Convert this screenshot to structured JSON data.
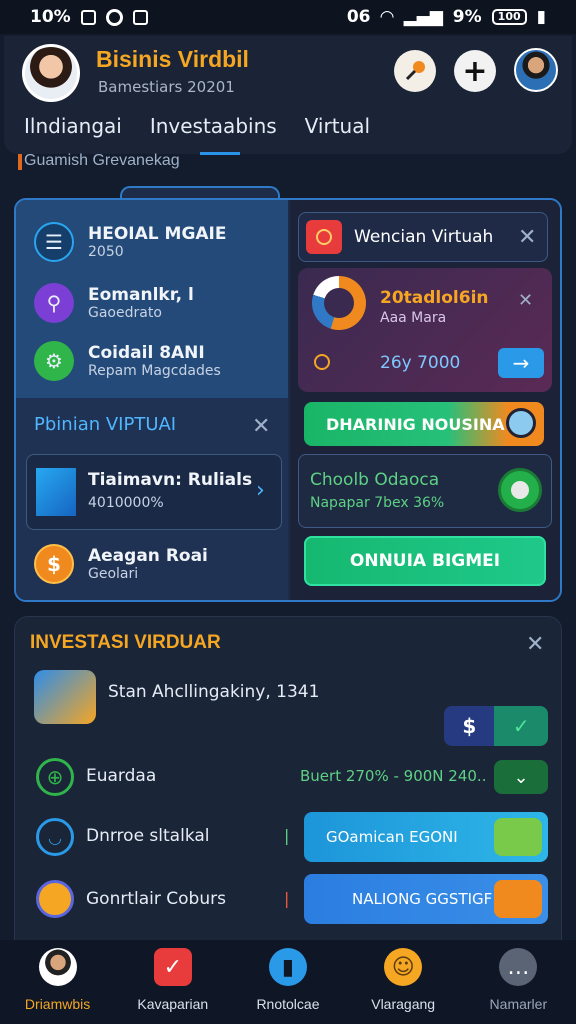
{
  "status_bar": {
    "left_time": "10%",
    "right_text": "06",
    "battery_pct": "9%",
    "battery_label": "100"
  },
  "header": {
    "title": "Bisinis Virdbil",
    "subtitle": "Bamestiars 20201",
    "tabs": [
      {
        "label": "Ilndiangai"
      },
      {
        "label": "Investaabins"
      },
      {
        "label": "Virtual"
      }
    ],
    "section_caption": "Guamish Grevanekag"
  },
  "left_items": [
    {
      "title": "HEOIAL MGAIE",
      "subtitle": "2050",
      "icon": "list-icon",
      "color": "#1e8fd8"
    },
    {
      "title": "Eomanlkr, l",
      "subtitle": "Gaoedrato",
      "icon": "pin-icon",
      "color": "#7c3fd6"
    },
    {
      "title": "Coidail 8ANI",
      "subtitle": "Repam Magcdades",
      "icon": "gear-icon",
      "color": "#2fb54a"
    }
  ],
  "pbinian": {
    "title": "Pbinian VIPTUAI"
  },
  "mini_card": {
    "title": "Tiaimavn: Rulials",
    "subtitle": "4010000%"
  },
  "coin_item": {
    "title": "Aeagan Roai",
    "subtitle": "Geolari"
  },
  "right": {
    "wencian_label": "Wencian Virtuah",
    "gauge_card": {
      "title": "20tadlol6in",
      "subtitle": "Aaa Mara",
      "value": "26y 7000"
    },
    "search_button_label": "DHARINIG NOUSINA",
    "choolb": {
      "title": "Choolb Odaoca",
      "subtitle": "Napapar 7bex 36%"
    },
    "green_button_label": "ONNUIA BIGMEI"
  },
  "invest": {
    "title": "INVESTASI VIRDUAR",
    "rows": [
      {
        "label": "Stan Ahcllingakiny, 1341"
      },
      {
        "label": "Euardaa",
        "meta": "Buert 270% - 900N 240.."
      },
      {
        "label": "Dnrroe sltalkal",
        "button": "GOamican EGONI"
      },
      {
        "label": "Gonrtlair Coburs",
        "button": "NALIONG GGSTIGF"
      }
    ],
    "dollar_symbol": "$"
  },
  "bottom_nav": [
    {
      "label": "Driamwbis",
      "icon": "profile-icon",
      "active": true
    },
    {
      "label": "Kavaparian",
      "icon": "checklist-icon"
    },
    {
      "label": "Rnotolcae",
      "icon": "bookmark-icon"
    },
    {
      "label": "Vlaragang",
      "icon": "smile-icon"
    },
    {
      "label": "Namarler",
      "icon": "chat-icon"
    }
  ],
  "colors": {
    "accent": "#f5a623",
    "panel_border": "#2f79c7",
    "green": "#1fc98a"
  }
}
